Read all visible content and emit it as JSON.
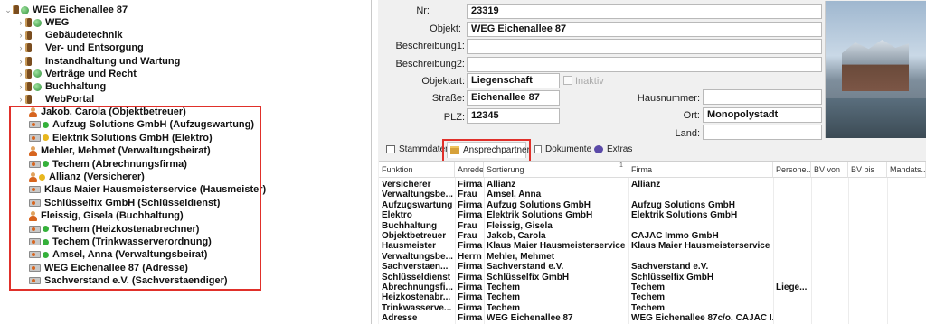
{
  "tree": {
    "root": "WEG Eichenallee 87",
    "folders": [
      "WEG",
      "Gebäudetechnik",
      "Ver- und Entsorgung",
      "Instandhaltung und Wartung",
      "Verträge und Recht",
      "Buchhaltung",
      "WebPortal"
    ],
    "contacts": [
      "Jakob, Carola (Objektbetreuer)",
      "Aufzug Solutions GmbH (Aufzugswartung)",
      "Elektrik Solutions GmbH (Elektro)",
      "Mehler, Mehmet (Verwaltungsbeirat)",
      "Techem (Abrechnungsfirma)",
      "Allianz (Versicherer)",
      "Klaus Maier Hausmeisterservice (Hausmeister)",
      "Schlüsselfix GmbH (Schlüsseldienst)",
      "Fleissig, Gisela (Buchhaltung)",
      "Techem (Heizkostenabrechner)",
      "Techem (Trinkwasserverordnung)",
      "Amsel, Anna (Verwaltungsbeirat)",
      "WEG Eichenallee 87  (Adresse)",
      "Sachverstand e.V. (Sachverstaendiger)"
    ]
  },
  "form": {
    "nr_label": "Nr:",
    "nr_value": "23319",
    "objekt_label": "Objekt:",
    "objekt_value": "WEG Eichenallee 87",
    "beschreibung1_label": "Beschreibung1:",
    "beschreibung2_label": "Beschreibung2:",
    "objektart_label": "Objektart:",
    "objektart_value": "Liegenschaft",
    "inaktiv_label": "Inaktiv",
    "strasse_label": "Straße:",
    "strasse_value": "Eichenallee 87",
    "hausnummer_label": "Hausnummer:",
    "plz_label": "PLZ:",
    "plz_value": "12345",
    "ort_label": "Ort:",
    "ort_value": "Monopolystadt",
    "land_label": "Land:"
  },
  "tabs": [
    "Stammdaten",
    "Ansprechpartner",
    "Dokumente",
    "Extras"
  ],
  "table": {
    "sort_indicator": "1",
    "headers": [
      "Funktion",
      "Anrede",
      "Sortierung",
      "Firma",
      "Persone...",
      "BV von",
      "BV bis",
      "Mandats..."
    ],
    "rows": [
      [
        "Versicherer",
        "Firma",
        "Allianz",
        "Allianz",
        ""
      ],
      [
        "Verwaltungsbe...",
        "Frau",
        "Amsel, Anna",
        "",
        ""
      ],
      [
        "Aufzugswartung",
        "Firma",
        "Aufzug Solutions GmbH",
        "Aufzug Solutions GmbH",
        ""
      ],
      [
        "Elektro",
        "Firma",
        "Elektrik Solutions GmbH",
        "Elektrik Solutions GmbH",
        ""
      ],
      [
        "Buchhaltung",
        "Frau",
        "Fleissig, Gisela",
        "",
        ""
      ],
      [
        "Objektbetreuer",
        "Frau",
        "Jakob, Carola",
        "CAJAC Immo GmbH",
        ""
      ],
      [
        "Hausmeister",
        "Firma",
        "Klaus Maier Hausmeisterservice",
        "Klaus Maier Hausmeisterservice",
        ""
      ],
      [
        "Verwaltungsbe...",
        "Herrn",
        "Mehler, Mehmet",
        "",
        ""
      ],
      [
        "Sachverstaen...",
        "Firma",
        "Sachverstand e.V.",
        "Sachverstand e.V.",
        ""
      ],
      [
        "Schlüsseldienst",
        "Firma",
        "Schlüsselfix GmbH",
        "Schlüsselfix GmbH",
        ""
      ],
      [
        "Abrechnungsfi...",
        "Firma",
        "Techem",
        "Techem",
        "Liege..."
      ],
      [
        "Heizkostenabr...",
        "Firma",
        "Techem",
        "Techem",
        ""
      ],
      [
        "Trinkwasserve...",
        "Firma",
        "Techem",
        "Techem",
        ""
      ],
      [
        "Adresse",
        "Firma",
        "WEG Eichenallee 87",
        "WEG Eichenallee 87c/o. CAJAC I...",
        ""
      ]
    ]
  }
}
